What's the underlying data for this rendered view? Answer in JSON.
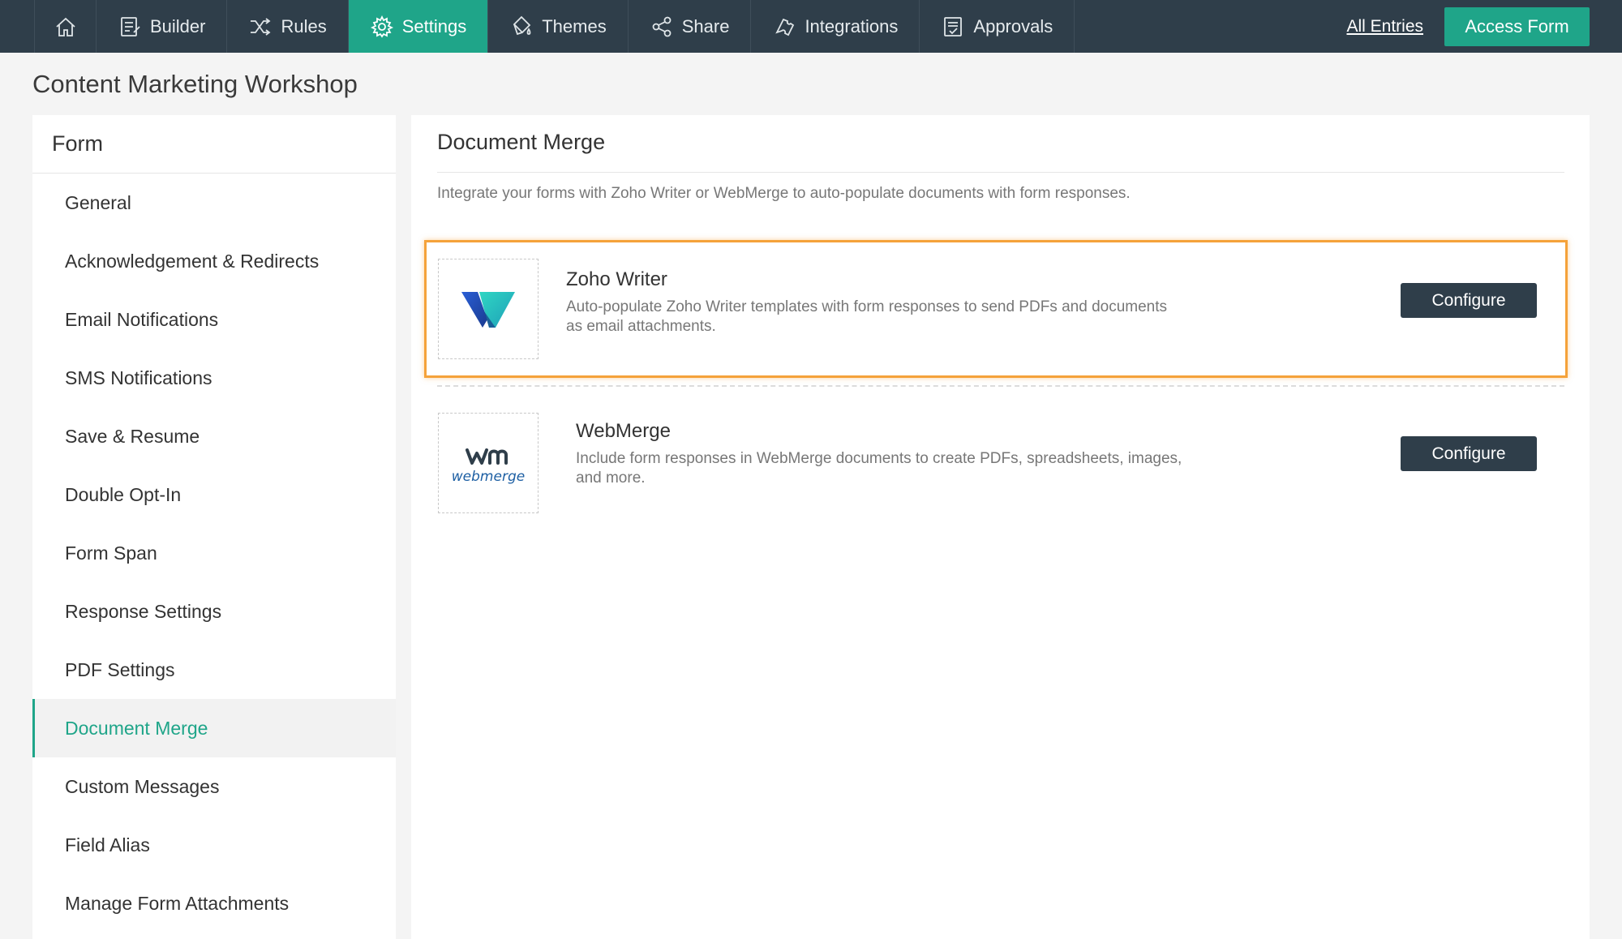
{
  "nav": {
    "items": [
      {
        "label": "Builder"
      },
      {
        "label": "Rules"
      },
      {
        "label": "Settings"
      },
      {
        "label": "Themes"
      },
      {
        "label": "Share"
      },
      {
        "label": "Integrations"
      },
      {
        "label": "Approvals"
      }
    ],
    "all_entries": "All Entries",
    "access_form": "Access Form"
  },
  "page": {
    "title": "Content Marketing Workshop"
  },
  "sidebar": {
    "heading": "Form",
    "items": [
      {
        "label": "General"
      },
      {
        "label": "Acknowledgement & Redirects"
      },
      {
        "label": "Email Notifications"
      },
      {
        "label": "SMS Notifications"
      },
      {
        "label": "Save & Resume"
      },
      {
        "label": "Double Opt-In"
      },
      {
        "label": "Form Span"
      },
      {
        "label": "Response Settings"
      },
      {
        "label": "PDF Settings"
      },
      {
        "label": "Document Merge"
      },
      {
        "label": "Custom Messages"
      },
      {
        "label": "Field Alias"
      },
      {
        "label": "Manage Form Attachments"
      }
    ]
  },
  "main": {
    "title": "Document Merge",
    "description": "Integrate your forms with Zoho Writer or WebMerge to auto-populate documents with form responses.",
    "integrations": [
      {
        "name": "Zoho Writer",
        "description": "Auto-populate Zoho Writer templates with form responses to send PDFs and documents as email attachments.",
        "button": "Configure"
      },
      {
        "name": "WebMerge",
        "description": "Include form responses in WebMerge documents to create PDFs, spreadsheets, images, and more.",
        "button": "Configure",
        "logo_text": "webmerge"
      }
    ]
  },
  "colors": {
    "accent": "#1fa589",
    "nav_bg": "#2f3e4a",
    "highlight": "#f5a23a"
  }
}
